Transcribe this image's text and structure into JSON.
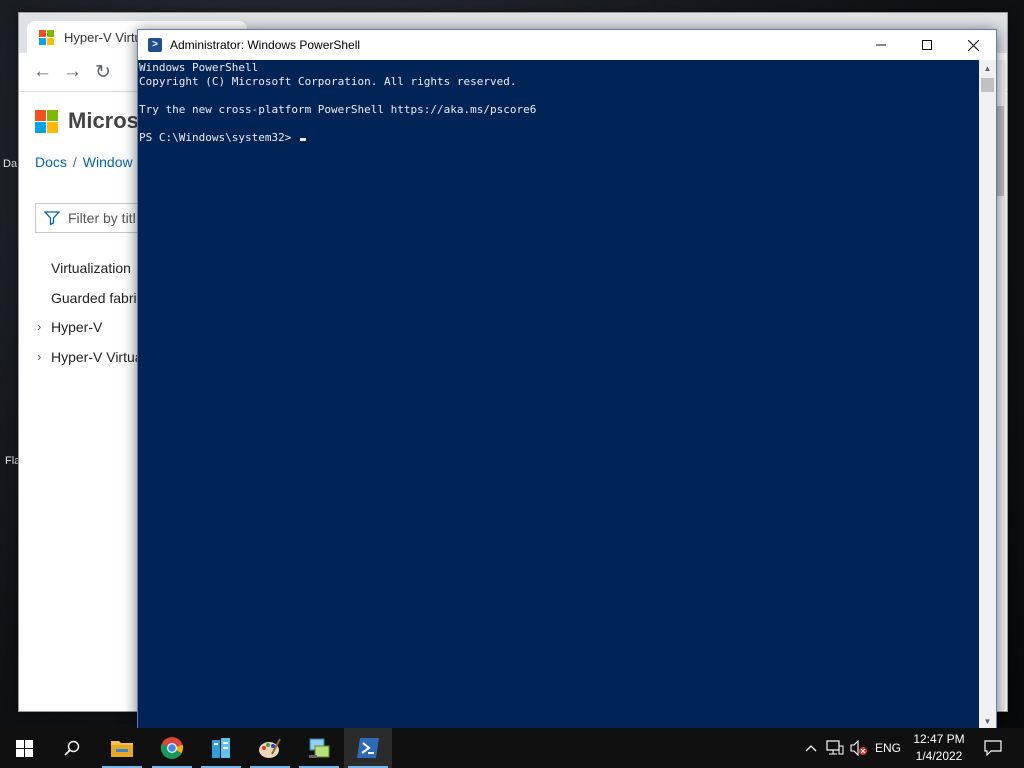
{
  "desktop": {
    "labels": [
      "Da",
      "Fla"
    ]
  },
  "browser": {
    "tab_title": "Hyper-V Virtu",
    "brand": "Microsof",
    "breadcrumb": [
      "Docs",
      "Window"
    ],
    "filter_placeholder": "Filter by titl",
    "toc": [
      {
        "label": "Virtualization",
        "expandable": false
      },
      {
        "label": "Guarded fabric",
        "expandable": false
      },
      {
        "label": "Hyper-V",
        "expandable": true
      },
      {
        "label": "Hyper-V Virtua",
        "expandable": true
      }
    ]
  },
  "powershell": {
    "title": "Administrator: Windows PowerShell",
    "lines": [
      "Windows PowerShell",
      "Copyright (C) Microsoft Corporation. All rights reserved.",
      "",
      "Try the new cross-platform PowerShell https://aka.ms/pscore6",
      ""
    ],
    "prompt": "PS C:\\Windows\\system32>",
    "colors": {
      "background": "#012456",
      "foreground": "#eeedf0"
    }
  },
  "taskbar": {
    "apps": [
      {
        "name": "file-explorer-icon"
      },
      {
        "name": "chrome-icon"
      },
      {
        "name": "server-manager-icon"
      },
      {
        "name": "paint-icon"
      },
      {
        "name": "network-app-icon"
      },
      {
        "name": "powershell-icon",
        "active": true
      }
    ],
    "language": "ENG",
    "time": "12:47 PM",
    "date": "1/4/2022"
  }
}
